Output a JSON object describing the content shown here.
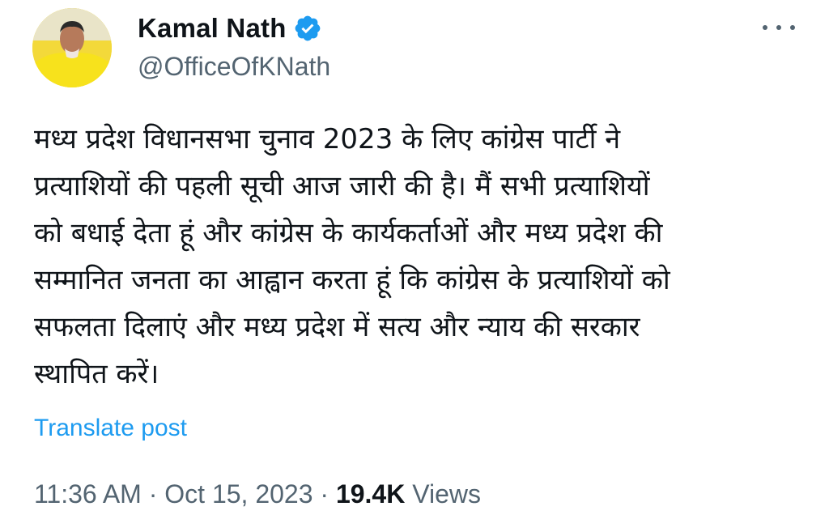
{
  "author": {
    "display_name": "Kamal Nath",
    "handle": "@OfficeOfKNath",
    "verified_icon": "verified-badge-icon",
    "avatar_icon": "profile-avatar"
  },
  "menu": {
    "icon": "more-options-icon"
  },
  "tweet": {
    "lines": [
      "मध्य प्रदेश विधानसभा चुनाव 2023 के लिए कांग्रेस पार्टी ने",
      "प्रत्याशियों की पहली सूची आज जारी की है। मैं सभी प्रत्याशियों",
      "को बधाई देता हूं और कांग्रेस के कार्यकर्ताओं और मध्य प्रदेश की",
      "सम्मानित जनता का आह्वान करता हूं कि कांग्रेस के प्रत्याशियों को",
      "सफलता दिलाएं और मध्य प्रदेश में सत्य और न्याय की सरकार",
      "स्थापित करें।"
    ]
  },
  "translate_label": "Translate post",
  "meta": {
    "time": "11:36 AM",
    "separator": "·",
    "date": "Oct 15, 2023",
    "views_count": "19.4K",
    "views_label": "Views"
  },
  "colors": {
    "accent": "#1d9bf0",
    "secondary_text": "#536471",
    "primary_text": "#0f1419"
  }
}
